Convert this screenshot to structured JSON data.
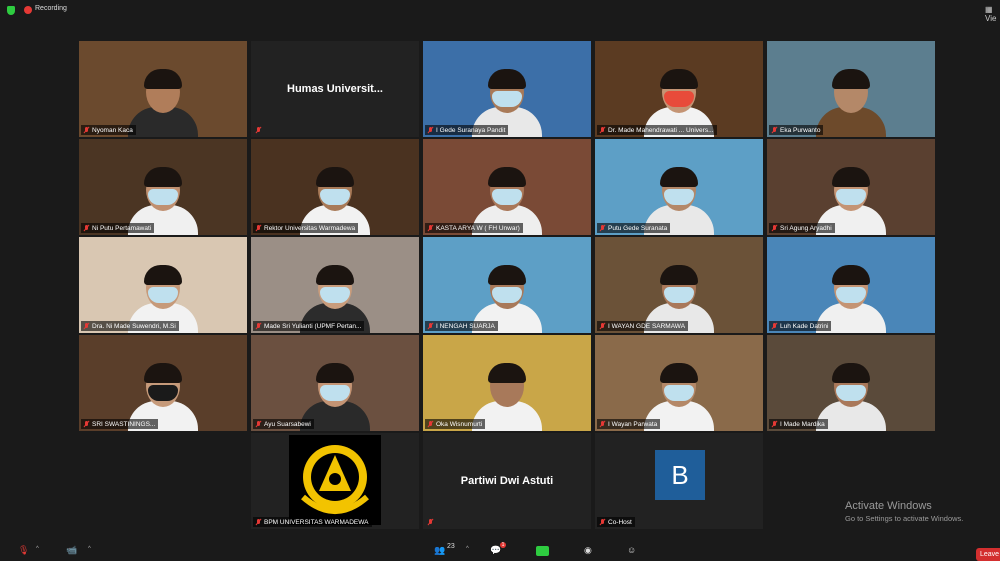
{
  "top_bar": {
    "recording_label": "Recording",
    "view_label": "Vie"
  },
  "tiles": [
    {
      "name": "Nyoman Kaca",
      "bg": "#6b4a2e",
      "skin": "#b07d5a",
      "shirt": "#2a2a2a",
      "mask": false
    },
    {
      "name": "",
      "center_name": "Humas Universit...",
      "bg": "#222222"
    },
    {
      "name": "I Gede Suranaya Pandit",
      "bg": "#3c6fa8",
      "skin": "#a97a58",
      "shirt": "#e8e8e8",
      "mask": true
    },
    {
      "name": "Dr. Made Mahendrawati ... Univers...",
      "bg": "#5b3b22",
      "skin": "#c49474",
      "shirt": "#f2f2f2",
      "mask": true,
      "mask_color": "#e84b3a",
      "active": true
    },
    {
      "name": "Eka Purwanto",
      "bg": "#5c7e8f",
      "skin": "#b48868",
      "shirt": "#6d4a2b",
      "mask": false
    },
    {
      "name": "Ni Putu Pertamawati",
      "bg": "#4b3523",
      "skin": "#c09070",
      "shirt": "#f0f0f0",
      "mask": true
    },
    {
      "name": "Rektor Universitas Warmadewa",
      "bg": "#4a3220",
      "skin": "#a87a58",
      "shirt": "#f2f2f2",
      "mask": true
    },
    {
      "name": "KASTA ARYA W ( FH Unwar)",
      "bg": "#7a4a36",
      "skin": "#a9785a",
      "shirt": "#eeeeee",
      "mask": true
    },
    {
      "name": "Putu Gede Suranata",
      "bg": "#5d9fc6",
      "skin": "#b48868",
      "shirt": "#e8e8e8",
      "mask": true
    },
    {
      "name": "Sri Agung Aryadhi",
      "bg": "#5a4030",
      "skin": "#c49474",
      "shirt": "#f0f0f0",
      "mask": true
    },
    {
      "name": "Dra. Ni Made Suwendri, M.Si",
      "bg": "#d9c7b2",
      "skin": "#c69a7a",
      "shirt": "#f2f2f2",
      "mask": true
    },
    {
      "name": "Made Sri Yulianti (UPMF Pertan...",
      "bg": "#9b8f86",
      "skin": "#c89c7c",
      "shirt": "#2c2c2c",
      "mask": true
    },
    {
      "name": "I NENGAH SUARJA",
      "bg": "#5d9fc6",
      "skin": "#a8795a",
      "shirt": "#f2f2f2",
      "mask": true
    },
    {
      "name": "I WAYAN GDE SARMAWA",
      "bg": "#6b5238",
      "skin": "#a9785a",
      "shirt": "#e8e8e8",
      "mask": true
    },
    {
      "name": "Luh Kade Datrini",
      "bg": "#4a86b8",
      "skin": "#c49474",
      "shirt": "#f0f0f0",
      "mask": true
    },
    {
      "name": "SRI SWASTININGS...",
      "bg": "#5a3e2a",
      "skin": "#c69a7a",
      "shirt": "#f2f2f2",
      "mask": true,
      "mask_color": "#1a1a1a"
    },
    {
      "name": "Ayu Suarsabewi",
      "bg": "#6b5040",
      "skin": "#c49474",
      "shirt": "#2a2a2a",
      "mask": true
    },
    {
      "name": "Oka Wisnumurti",
      "bg": "#c9a648",
      "skin": "#a8795a",
      "shirt": "#f2f2f2",
      "mask": false
    },
    {
      "name": "I Wayan Parwata",
      "bg": "#8a6a4a",
      "skin": "#b48868",
      "shirt": "#f2f2f2",
      "mask": true
    },
    {
      "name": "I Made Mardika",
      "bg": "#5a4a3a",
      "skin": "#a9785a",
      "shirt": "#e8e8e8",
      "mask": true
    },
    {
      "name": "BPM UNIVERSITAS WARMADEWA",
      "logo": true,
      "bg": "#222222"
    },
    {
      "name": "",
      "center_name": "Partiwi Dwi Astuti",
      "bg": "#222222"
    },
    {
      "name": "Co-Host",
      "avatar_letter": "B",
      "bg": "#222222"
    }
  ],
  "watermark": {
    "title": "Activate Windows",
    "subtitle": "Go to Settings to activate Windows."
  },
  "bottom_bar": {
    "participants_count": "23",
    "chat_badge": "1",
    "leave_label": "Leave"
  }
}
